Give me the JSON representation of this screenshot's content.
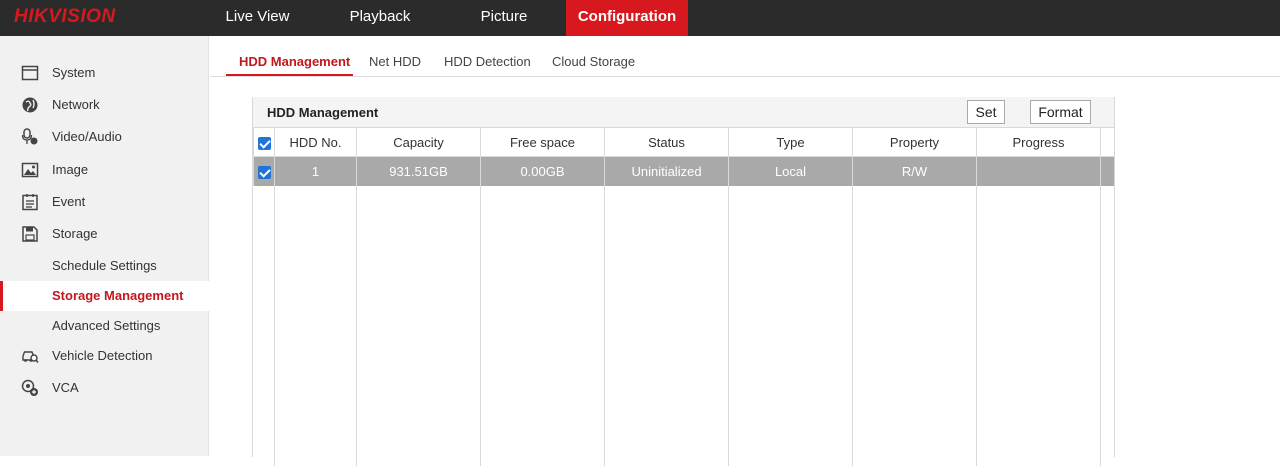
{
  "brand": {
    "logo": "HIKVISION",
    "accent": "#d7191f"
  },
  "topnav": {
    "items": [
      {
        "label": "Live View"
      },
      {
        "label": "Playback"
      },
      {
        "label": "Picture"
      },
      {
        "label": "Configuration",
        "active": true
      }
    ]
  },
  "sidebar": {
    "items": [
      {
        "label": "System",
        "icon": "system-icon"
      },
      {
        "label": "Network",
        "icon": "globe-icon"
      },
      {
        "label": "Video/Audio",
        "icon": "microphone-icon"
      },
      {
        "label": "Image",
        "icon": "image-icon"
      },
      {
        "label": "Event",
        "icon": "event-icon"
      },
      {
        "label": "Storage",
        "icon": "floppy-disk-icon"
      },
      {
        "label": "Schedule Settings"
      },
      {
        "label": "Storage Management",
        "active": true
      },
      {
        "label": "Advanced Settings"
      },
      {
        "label": "Vehicle Detection",
        "icon": "vehicle-detection-icon"
      },
      {
        "label": "VCA",
        "icon": "vca-icon"
      }
    ]
  },
  "tabs": [
    {
      "label": "HDD Management",
      "active": true
    },
    {
      "label": "Net HDD"
    },
    {
      "label": "HDD Detection"
    },
    {
      "label": "Cloud Storage"
    }
  ],
  "panel": {
    "title": "HDD Management",
    "set_label": "Set",
    "format_label": "Format"
  },
  "table": {
    "columns": [
      "HDD No.",
      "Capacity",
      "Free space",
      "Status",
      "Type",
      "Property",
      "Progress"
    ],
    "rows": [
      {
        "hdd_no": "1",
        "capacity": "931.51GB",
        "free_space": "0.00GB",
        "status": "Uninitialized",
        "type": "Local",
        "property": "R/W",
        "progress": "",
        "checked": true
      }
    ],
    "header_checked": true
  }
}
